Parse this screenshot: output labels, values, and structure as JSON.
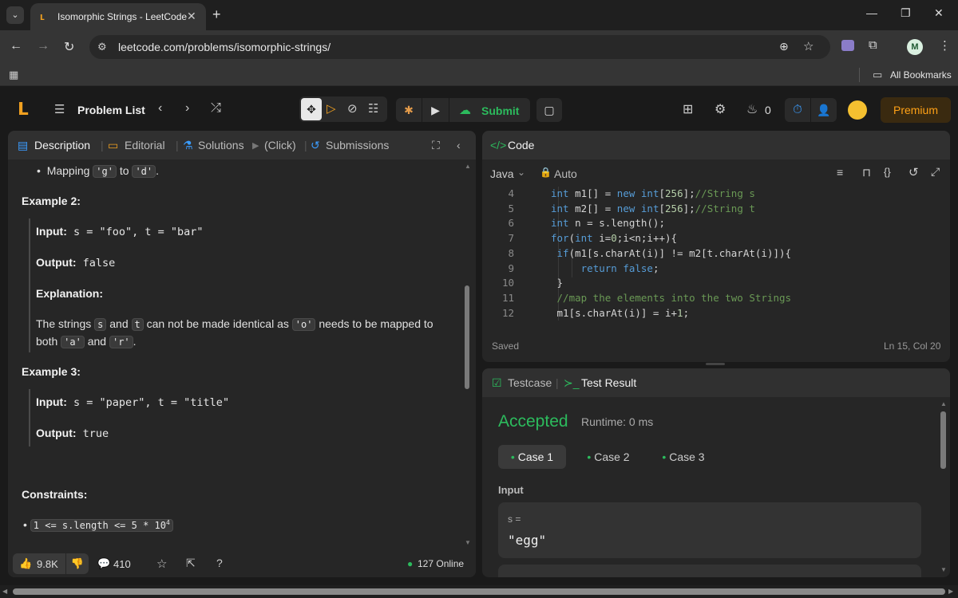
{
  "browser": {
    "tab_title": "Isomorphic Strings - LeetCode",
    "url": "leetcode.com/problems/isomorphic-strings/",
    "profile_initial": "M",
    "bookmarks_label": "All Bookmarks"
  },
  "header": {
    "problem_list": "Problem List",
    "submit": "Submit",
    "fire_count": "0",
    "premium": "Premium"
  },
  "description_tabs": {
    "description": "Description",
    "editorial": "Editorial",
    "solutions": "Solutions",
    "click": "(Click)",
    "submissions": "Submissions"
  },
  "description": {
    "mapping_prefix": "Mapping ",
    "mapping_from": "'g'",
    "mapping_to_word": " to ",
    "mapping_to": "'d'",
    "mapping_end": ".",
    "example2_title": "Example 2:",
    "ex2_input_label": "Input:",
    "ex2_input_value": " s = \"foo\", t = \"bar\"",
    "ex2_output_label": "Output:",
    "ex2_output_value": " false",
    "ex2_expl_label": "Explanation:",
    "ex2_expl_1a": "The strings ",
    "ex2_expl_s": "s",
    "ex2_expl_and": " and ",
    "ex2_expl_t": "t",
    "ex2_expl_1b": " can not be made identical as ",
    "ex2_expl_o": "'o'",
    "ex2_expl_1c": " needs to be mapped to",
    "ex2_expl_2a": "both ",
    "ex2_expl_a": "'a'",
    "ex2_expl_and2": " and ",
    "ex2_expl_r": "'r'",
    "ex2_expl_end": ".",
    "example3_title": "Example 3:",
    "ex3_input_label": "Input:",
    "ex3_input_value": " s = \"paper\", t = \"title\"",
    "ex3_output_label": "Output:",
    "ex3_output_value": " true",
    "constraints_title": "Constraints:",
    "constraint_1": "1 <= s.length <= 5 * 10",
    "constraint_1_exp": "4"
  },
  "footer": {
    "likes": "9.8K",
    "comments": "410",
    "online": "127 Online"
  },
  "code_panel": {
    "title": "Code",
    "language": "Java",
    "mode": "Auto",
    "status": "Saved",
    "cursor": "Ln 15, Col 20",
    "lines": [
      {
        "n": "4",
        "code": "int m1[] = new int[256];//String s"
      },
      {
        "n": "5",
        "code": "int m2[] = new int[256];//String t"
      },
      {
        "n": "6",
        "code": "int n = s.length();"
      },
      {
        "n": "7",
        "code": "for(int i=0;i<n;i++){"
      },
      {
        "n": "8",
        "code": " if(m1[s.charAt(i)] != m2[t.charAt(i)]){"
      },
      {
        "n": "9",
        "code": "     return false;"
      },
      {
        "n": "10",
        "code": " }"
      },
      {
        "n": "11",
        "code": " //map the elements into the two Strings"
      },
      {
        "n": "12",
        "code": " m1[s.charAt(i)] = i+1;"
      }
    ]
  },
  "result_panel": {
    "tab_testcase": "Testcase",
    "tab_result": "Test Result",
    "verdict": "Accepted",
    "runtime": "Runtime: 0 ms",
    "cases": [
      "Case 1",
      "Case 2",
      "Case 3"
    ],
    "input_label": "Input",
    "var_label": "s =",
    "var_value": "\"egg\""
  },
  "colors": {
    "accepted": "#2cbb5d",
    "premium": "#ffa116",
    "timer": "#3b9dff"
  }
}
